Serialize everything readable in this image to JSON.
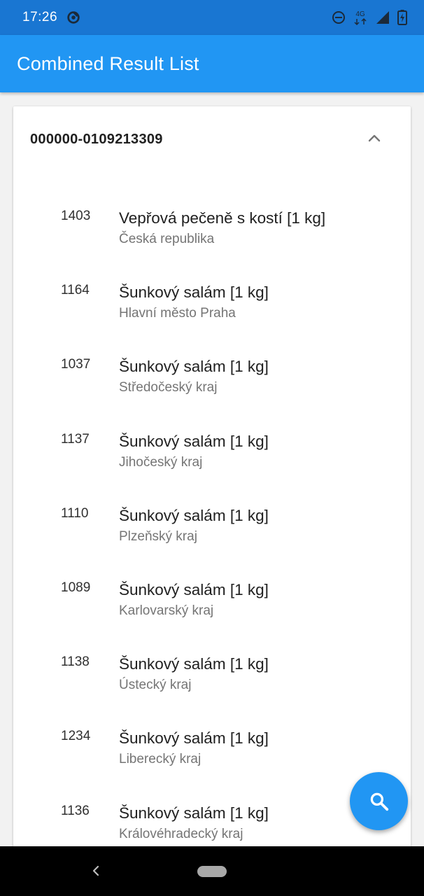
{
  "status_bar": {
    "time": "17:26",
    "network": "4G",
    "icons": [
      "sync-icon",
      "do-not-disturb-icon",
      "network-4g-icon",
      "signal-icon",
      "battery-icon"
    ]
  },
  "app_bar": {
    "title": "Combined Result List"
  },
  "card": {
    "title": "000000-0109213309",
    "expanded": true,
    "items": [
      {
        "code": "1403",
        "name": "Vepřová pečeně s kostí [1 kg]",
        "region": "Česká republika"
      },
      {
        "code": "1164",
        "name": "Šunkový salám [1 kg]",
        "region": "Hlavní město Praha"
      },
      {
        "code": "1037",
        "name": "Šunkový salám [1 kg]",
        "region": "Středočeský kraj"
      },
      {
        "code": "1137",
        "name": "Šunkový salám [1 kg]",
        "region": "Jihočeský kraj"
      },
      {
        "code": "1110",
        "name": "Šunkový salám [1 kg]",
        "region": "Plzeňský kraj"
      },
      {
        "code": "1089",
        "name": "Šunkový salám [1 kg]",
        "region": "Karlovarský kraj"
      },
      {
        "code": "1138",
        "name": "Šunkový salám [1 kg]",
        "region": "Ústecký kraj"
      },
      {
        "code": "1234",
        "name": "Šunkový salám [1 kg]",
        "region": "Liberecký kraj"
      },
      {
        "code": "1136",
        "name": "Šunkový salám [1 kg]",
        "region": "Královéhradecký kraj"
      }
    ]
  },
  "fab": {
    "icon": "search-icon",
    "color": "#2196f3"
  },
  "colors": {
    "status_bar": "#1976d2",
    "app_bar": "#2196f3",
    "background": "#f2f2f2",
    "secondary_text": "#757575"
  }
}
